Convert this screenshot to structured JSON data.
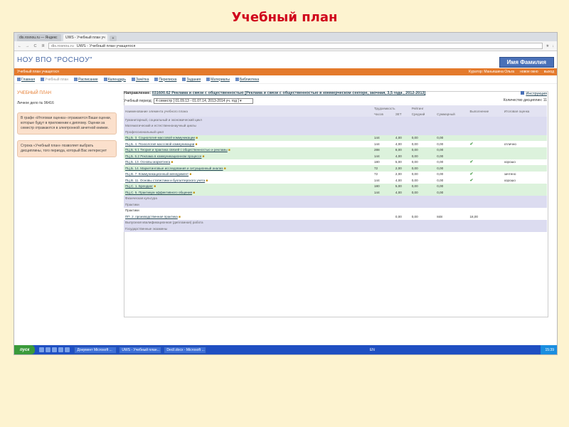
{
  "slide_title": "Учебный план",
  "browser": {
    "tabs": [
      "dis.rosnou.ru — Яндекс",
      "UWS - Учебный план уч"
    ],
    "url_host": "dis.rosnou.ru",
    "url_page": "UWS - Учебный план учащегося"
  },
  "site": {
    "name": "НОУ ВПО \"РОСНОУ\"",
    "user_button": "Имя Фамилия"
  },
  "orange_bar": {
    "left": "Учебный план учащегося",
    "curator": "Куратор: Маньяшина Ольга",
    "messages": "новое окно",
    "exit": "выход"
  },
  "menu": [
    "Главная",
    "Учебный план",
    "Расписание",
    "Календарь",
    "Зачётка",
    "Переписка",
    "Задания",
    "Материалы",
    "Библиотека"
  ],
  "sidebar": {
    "title": "УЧЕБНЫЙ ПЛАН",
    "deal": "Личное дело № 96416",
    "note1": "В графе «Итоговая оценка» отражаются Ваши оценки, которые будут в приложении к диплому. Оценки за семестр отражаются в электронной зачетной книжке.",
    "note2": "Строка «Учебный план» позволяет выбрать дисциплины, того периода, который Вас интересует"
  },
  "main": {
    "dir_label": "Направление:",
    "dir_value": "031600.62 Реклама и связи с общественностью [Реклама и связи с общественностью в коммерческом секторе, заочная, 3,5 года , 2012-2013]",
    "instruction": "Инструкция",
    "period_label": "Учебный период:",
    "period_value": "4 семестр [ 01.09.13 - 01.07.14, 2013-2014 уч. год ]",
    "count": "Количество дисциплин: 11"
  },
  "table": {
    "headers": {
      "name": "Наименование элемента учебного плана",
      "labor": "Трудоемкость",
      "hours": "Часов",
      "zet": "ЗЕТ",
      "rating": "Рейтинг",
      "avg": "Средний",
      "sum": "Суммарный",
      "done": "Выполнение",
      "final": "Итоговая оценка"
    },
    "rows": [
      {
        "t": "sec",
        "name": "Гуманитарный, социальный и экономический цикл"
      },
      {
        "t": "sec",
        "name": "Математический и естественнонаучный циклы"
      },
      {
        "t": "sec",
        "name": "Профессиональный цикл"
      },
      {
        "t": "g",
        "name": "ПЦ.Б. 3. Социология массовой коммуникации",
        "hours": "144",
        "zet": "4,00",
        "avg": "0,00",
        "sum": "0,00",
        "check": false,
        "grade": ""
      },
      {
        "t": "w",
        "name": "ПЦ.Б. 4. Психология массовой коммуникации",
        "hours": "144",
        "zet": "4,00",
        "avg": "0,00",
        "sum": "0,00",
        "check": true,
        "grade": "отлично"
      },
      {
        "t": "g",
        "name": "ПЦ.Б. 6.1 Теория и практика связей с общественностью и рекламы",
        "hours": "288",
        "zet": "8,00",
        "avg": "0,00",
        "sum": "0,00",
        "check": false,
        "grade": ""
      },
      {
        "t": "g",
        "name": "ПЦ.Б. 6.2 Реклама в коммуникационном процессе",
        "hours": "144",
        "zet": "4,00",
        "avg": "0,00",
        "sum": "0,00",
        "check": false,
        "grade": ""
      },
      {
        "t": "w",
        "name": "ПЦ.Б. 13. Основы маркетинга",
        "hours": "180",
        "zet": "5,00",
        "avg": "0,00",
        "sum": "0,00",
        "check": true,
        "grade": "хорошо"
      },
      {
        "t": "g",
        "name": "ПЦ.Б. 14. Маркетинговые исследования и ситуационный анализ",
        "hours": "72",
        "zet": "2,00",
        "avg": "0,00",
        "sum": "0,00",
        "check": false,
        "grade": ""
      },
      {
        "t": "w",
        "name": "ПЦ.В. 7. Коммуникационный менеджмент",
        "hours": "72",
        "zet": "2,00",
        "avg": "0,00",
        "sum": "0,00",
        "check": true,
        "grade": "зачтено"
      },
      {
        "t": "w",
        "name": "ПЦ.В. 11. Основы статистики и бухгалтерского учета",
        "hours": "144",
        "zet": "4,00",
        "avg": "0,00",
        "sum": "0,00",
        "check": true,
        "grade": "хорошо"
      },
      {
        "t": "g",
        "name": "ПЦ.С. 1. Брендинг",
        "hours": "180",
        "zet": "5,00",
        "avg": "0,00",
        "sum": "0,00",
        "check": false,
        "grade": ""
      },
      {
        "t": "g",
        "name": "ПЦ.С. 5. Практикум эффективного общения",
        "hours": "144",
        "zet": "4,00",
        "avg": "0,00",
        "sum": "0,00",
        "check": false,
        "grade": ""
      },
      {
        "t": "sec",
        "name": "Физическая культура"
      },
      {
        "t": "sec",
        "name": "Практики"
      },
      {
        "t": "w",
        "name": "Практики",
        "plain": true
      },
      {
        "t": "w",
        "name": "ПП. 2. производственная практика",
        "hours": "",
        "zet": "0,00",
        "avg": "0,00",
        "sum": "848",
        "extra": "18,00",
        "check": false,
        "grade": ""
      },
      {
        "t": "sec",
        "name": "Выпускная квалификационная (дипломная) работа"
      },
      {
        "t": "sec",
        "name": "Государственные экзамены"
      }
    ]
  },
  "taskbar": {
    "start": "пуск",
    "items": [
      "Документ Microsoft ...",
      "UWS - Учебный план...",
      "Decll.docx - Microsoft ..."
    ],
    "lang": "EN",
    "time": "15:39"
  }
}
